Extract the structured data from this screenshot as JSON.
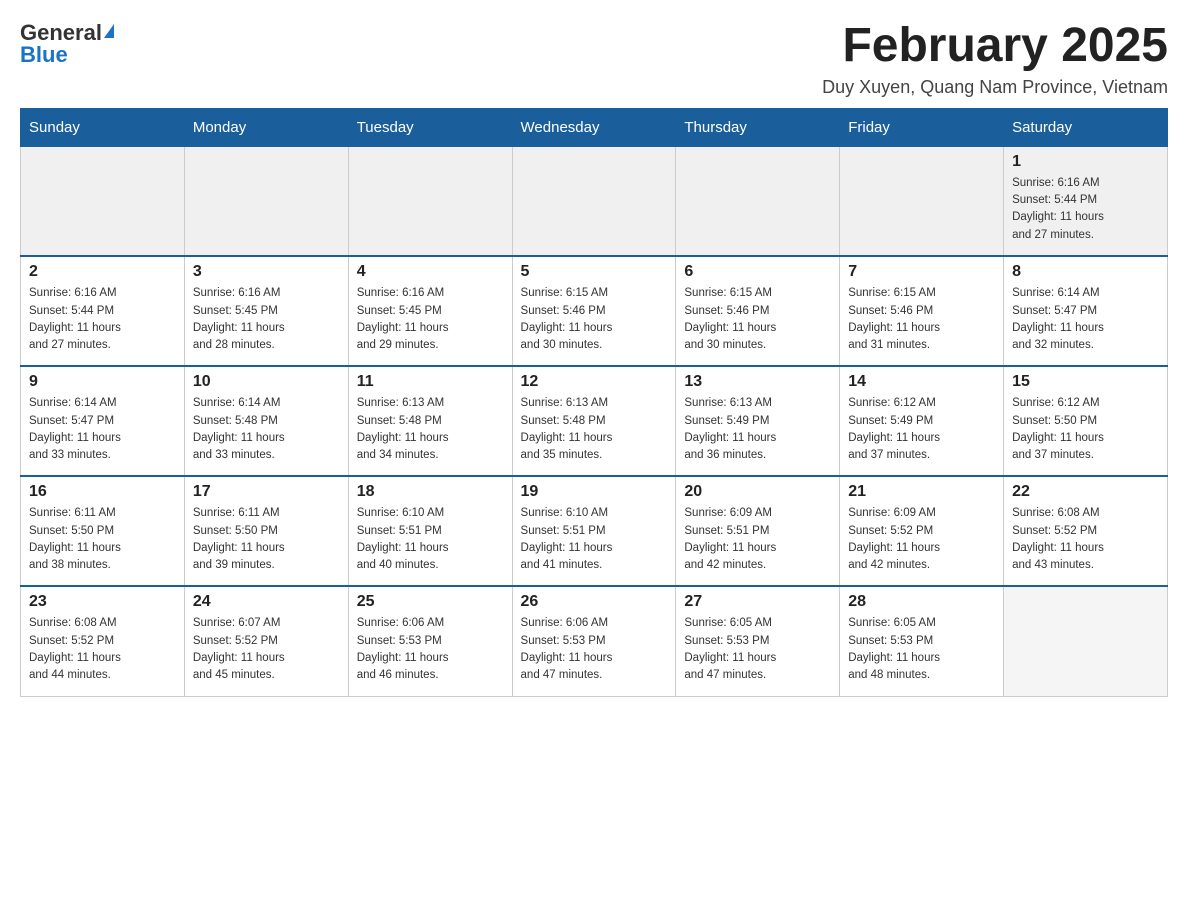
{
  "logo": {
    "general": "General",
    "arrow": "▶",
    "blue": "Blue"
  },
  "header": {
    "title": "February 2025",
    "subtitle": "Duy Xuyen, Quang Nam Province, Vietnam"
  },
  "weekdays": [
    "Sunday",
    "Monday",
    "Tuesday",
    "Wednesday",
    "Thursday",
    "Friday",
    "Saturday"
  ],
  "weeks": [
    [
      {
        "day": "",
        "info": ""
      },
      {
        "day": "",
        "info": ""
      },
      {
        "day": "",
        "info": ""
      },
      {
        "day": "",
        "info": ""
      },
      {
        "day": "",
        "info": ""
      },
      {
        "day": "",
        "info": ""
      },
      {
        "day": "1",
        "info": "Sunrise: 6:16 AM\nSunset: 5:44 PM\nDaylight: 11 hours\nand 27 minutes."
      }
    ],
    [
      {
        "day": "2",
        "info": "Sunrise: 6:16 AM\nSunset: 5:44 PM\nDaylight: 11 hours\nand 27 minutes."
      },
      {
        "day": "3",
        "info": "Sunrise: 6:16 AM\nSunset: 5:45 PM\nDaylight: 11 hours\nand 28 minutes."
      },
      {
        "day": "4",
        "info": "Sunrise: 6:16 AM\nSunset: 5:45 PM\nDaylight: 11 hours\nand 29 minutes."
      },
      {
        "day": "5",
        "info": "Sunrise: 6:15 AM\nSunset: 5:46 PM\nDaylight: 11 hours\nand 30 minutes."
      },
      {
        "day": "6",
        "info": "Sunrise: 6:15 AM\nSunset: 5:46 PM\nDaylight: 11 hours\nand 30 minutes."
      },
      {
        "day": "7",
        "info": "Sunrise: 6:15 AM\nSunset: 5:46 PM\nDaylight: 11 hours\nand 31 minutes."
      },
      {
        "day": "8",
        "info": "Sunrise: 6:14 AM\nSunset: 5:47 PM\nDaylight: 11 hours\nand 32 minutes."
      }
    ],
    [
      {
        "day": "9",
        "info": "Sunrise: 6:14 AM\nSunset: 5:47 PM\nDaylight: 11 hours\nand 33 minutes."
      },
      {
        "day": "10",
        "info": "Sunrise: 6:14 AM\nSunset: 5:48 PM\nDaylight: 11 hours\nand 33 minutes."
      },
      {
        "day": "11",
        "info": "Sunrise: 6:13 AM\nSunset: 5:48 PM\nDaylight: 11 hours\nand 34 minutes."
      },
      {
        "day": "12",
        "info": "Sunrise: 6:13 AM\nSunset: 5:48 PM\nDaylight: 11 hours\nand 35 minutes."
      },
      {
        "day": "13",
        "info": "Sunrise: 6:13 AM\nSunset: 5:49 PM\nDaylight: 11 hours\nand 36 minutes."
      },
      {
        "day": "14",
        "info": "Sunrise: 6:12 AM\nSunset: 5:49 PM\nDaylight: 11 hours\nand 37 minutes."
      },
      {
        "day": "15",
        "info": "Sunrise: 6:12 AM\nSunset: 5:50 PM\nDaylight: 11 hours\nand 37 minutes."
      }
    ],
    [
      {
        "day": "16",
        "info": "Sunrise: 6:11 AM\nSunset: 5:50 PM\nDaylight: 11 hours\nand 38 minutes."
      },
      {
        "day": "17",
        "info": "Sunrise: 6:11 AM\nSunset: 5:50 PM\nDaylight: 11 hours\nand 39 minutes."
      },
      {
        "day": "18",
        "info": "Sunrise: 6:10 AM\nSunset: 5:51 PM\nDaylight: 11 hours\nand 40 minutes."
      },
      {
        "day": "19",
        "info": "Sunrise: 6:10 AM\nSunset: 5:51 PM\nDaylight: 11 hours\nand 41 minutes."
      },
      {
        "day": "20",
        "info": "Sunrise: 6:09 AM\nSunset: 5:51 PM\nDaylight: 11 hours\nand 42 minutes."
      },
      {
        "day": "21",
        "info": "Sunrise: 6:09 AM\nSunset: 5:52 PM\nDaylight: 11 hours\nand 42 minutes."
      },
      {
        "day": "22",
        "info": "Sunrise: 6:08 AM\nSunset: 5:52 PM\nDaylight: 11 hours\nand 43 minutes."
      }
    ],
    [
      {
        "day": "23",
        "info": "Sunrise: 6:08 AM\nSunset: 5:52 PM\nDaylight: 11 hours\nand 44 minutes."
      },
      {
        "day": "24",
        "info": "Sunrise: 6:07 AM\nSunset: 5:52 PM\nDaylight: 11 hours\nand 45 minutes."
      },
      {
        "day": "25",
        "info": "Sunrise: 6:06 AM\nSunset: 5:53 PM\nDaylight: 11 hours\nand 46 minutes."
      },
      {
        "day": "26",
        "info": "Sunrise: 6:06 AM\nSunset: 5:53 PM\nDaylight: 11 hours\nand 47 minutes."
      },
      {
        "day": "27",
        "info": "Sunrise: 6:05 AM\nSunset: 5:53 PM\nDaylight: 11 hours\nand 47 minutes."
      },
      {
        "day": "28",
        "info": "Sunrise: 6:05 AM\nSunset: 5:53 PM\nDaylight: 11 hours\nand 48 minutes."
      },
      {
        "day": "",
        "info": ""
      }
    ]
  ]
}
